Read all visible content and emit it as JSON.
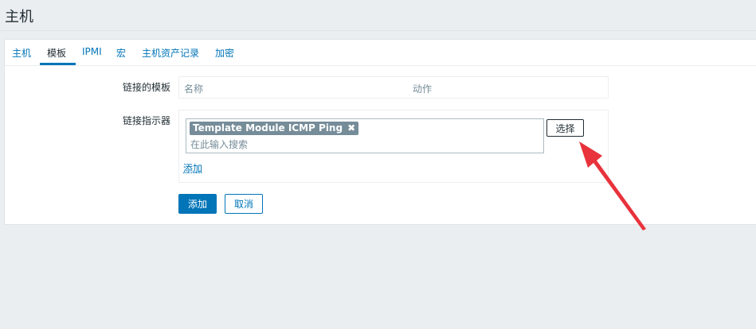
{
  "page": {
    "title": "主机"
  },
  "tabs": [
    {
      "label": "主机",
      "active": false
    },
    {
      "label": "模板",
      "active": true
    },
    {
      "label": "IPMI",
      "active": false
    },
    {
      "label": "宏",
      "active": false
    },
    {
      "label": "主机资产记录",
      "active": false
    },
    {
      "label": "加密",
      "active": false
    }
  ],
  "linked_templates": {
    "label": "链接的模板",
    "columns": [
      "名称",
      "动作"
    ]
  },
  "link_indicator": {
    "label": "链接指示器",
    "selected_tag": "Template Module ICMP Ping",
    "remove_glyph": "✖",
    "search_placeholder": "在此输入搜索",
    "select_button": "选择",
    "add_link": "添加"
  },
  "form_buttons": {
    "add": "添加",
    "cancel": "取消"
  },
  "colors": {
    "accent": "#0275b8",
    "tag_bg": "#768d99",
    "annotation_arrow": "#e8323c"
  }
}
